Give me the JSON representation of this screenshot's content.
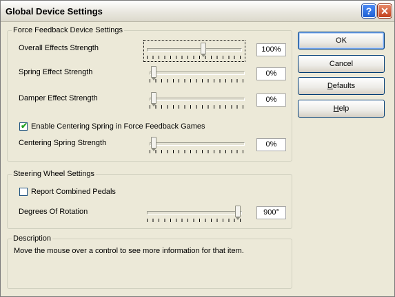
{
  "window": {
    "title": "Global Device Settings"
  },
  "titlebar_buttons": {
    "help": "?",
    "close": "✕"
  },
  "force_feedback": {
    "legend": "Force Feedback Device Settings",
    "overall": {
      "label": "Overall Effects Strength",
      "value_text": "100%",
      "level": 0.6
    },
    "spring": {
      "label": "Spring Effect Strength",
      "value_text": "0%",
      "level": 0.0
    },
    "damper": {
      "label": "Damper Effect Strength",
      "value_text": "0%",
      "level": 0.0
    },
    "centering_checkbox": {
      "label": "Enable Centering Spring in Force Feedback Games",
      "checked": true,
      "mark": "✔"
    },
    "centering": {
      "label": "Centering Spring Strength",
      "value_text": "0%",
      "level": 0.0
    }
  },
  "steering": {
    "legend": "Steering Wheel Settings",
    "combined_pedals": {
      "label": "Report Combined Pedals",
      "checked": false
    },
    "rotation": {
      "label": "Degrees Of Rotation",
      "value_text": "900°",
      "level": 1.0
    }
  },
  "description": {
    "legend": "Description",
    "text": "Move the mouse over a control to see more information for that item."
  },
  "buttons": {
    "ok": "OK",
    "cancel": "Cancel",
    "defaults": {
      "underlined": "D",
      "rest": "efaults"
    },
    "help": {
      "underlined": "H",
      "rest": "elp"
    }
  }
}
